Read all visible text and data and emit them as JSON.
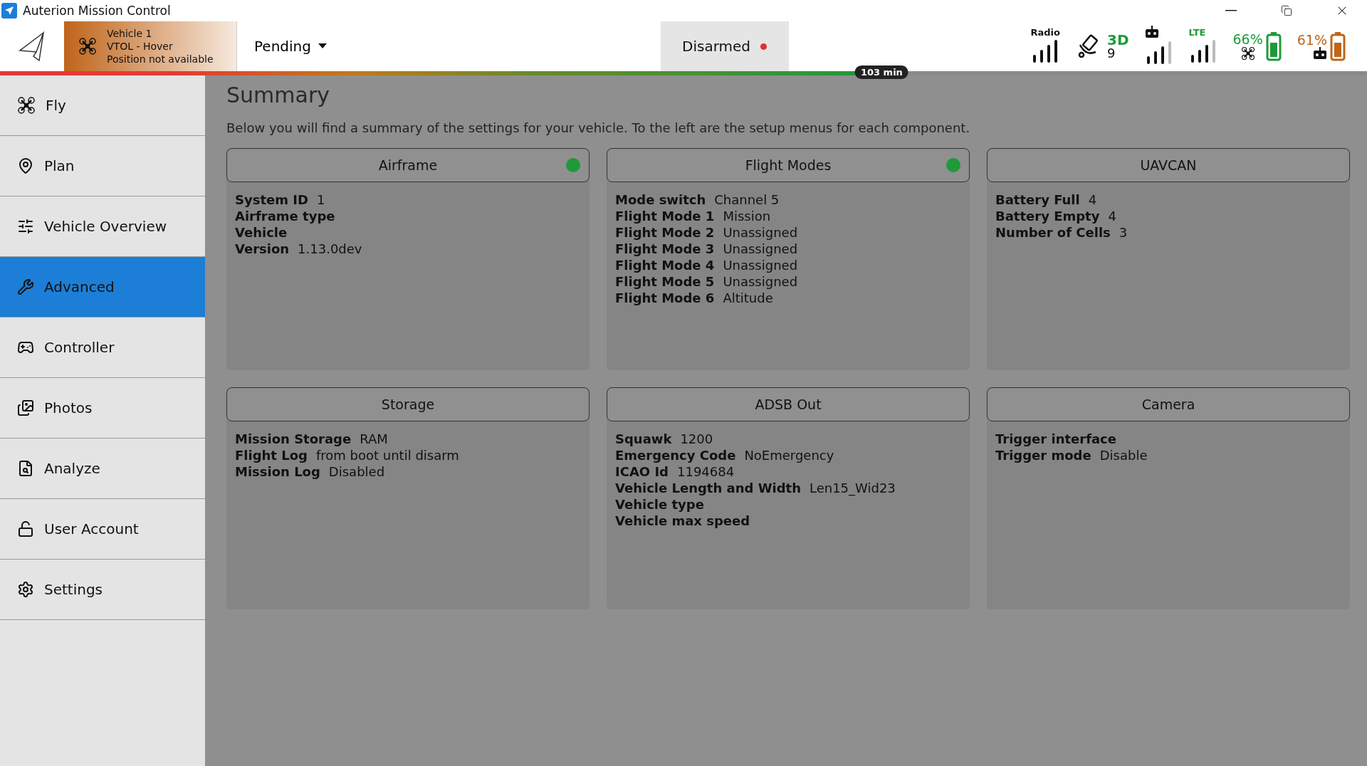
{
  "window": {
    "title": "Auterion Mission Control"
  },
  "toolbar": {
    "vehicle": {
      "lines": [
        "Vehicle 1",
        "VTOL - Hover",
        "Position not available"
      ]
    },
    "flight_status": "Pending",
    "arm_state": "Disarmed",
    "flight_time": {
      "label": "103 min",
      "level": 0.645
    },
    "indicators": [
      {
        "kind": "radio",
        "label": "Radio"
      },
      {
        "kind": "gps",
        "fix": "3D",
        "count": "9"
      },
      {
        "kind": "rc"
      },
      {
        "kind": "lte",
        "label": "LTE"
      },
      {
        "kind": "vehicle_battery",
        "label": "66%",
        "color": "#1e9a3a"
      },
      {
        "kind": "rc_battery",
        "label": "61%",
        "color": "#c0651a"
      }
    ]
  },
  "drawer": {
    "items": [
      {
        "kind": "fly",
        "label": "Fly",
        "selected": false
      },
      {
        "kind": "plan",
        "label": "Plan",
        "selected": false
      },
      {
        "kind": "overview",
        "label": "Vehicle Overview",
        "selected": false
      },
      {
        "kind": "advanced",
        "label": "Advanced",
        "selected": true
      },
      {
        "kind": "controller",
        "label": "Controller",
        "selected": false
      },
      {
        "kind": "photos",
        "label": "Photos",
        "selected": false
      },
      {
        "kind": "analyze",
        "label": "Analyze",
        "selected": false
      },
      {
        "kind": "account",
        "label": "User Account",
        "selected": false
      },
      {
        "kind": "settings",
        "label": "Settings",
        "selected": false
      }
    ]
  },
  "summary": {
    "title": "Summary",
    "description": "Below you will find a summary of the settings for your vehicle. To the left are the setup menus for each component.",
    "cards": [
      {
        "title": "Airframe",
        "ok": true,
        "rows": [
          {
            "label": "System ID",
            "value": "1"
          },
          {
            "label": "Airframe type"
          },
          {
            "label": "Vehicle"
          },
          {
            "label": "Version",
            "value": "1.13.0dev"
          }
        ]
      },
      {
        "title": "Flight Modes",
        "ok": true,
        "rows": [
          {
            "label": "Mode switch",
            "value": "Channel 5"
          },
          {
            "label": "Flight Mode 1",
            "value": "Mission"
          },
          {
            "label": "Flight Mode 2",
            "value": "Unassigned"
          },
          {
            "label": "Flight Mode 3",
            "value": "Unassigned"
          },
          {
            "label": "Flight Mode 4",
            "value": "Unassigned"
          },
          {
            "label": "Flight Mode 5",
            "value": "Unassigned"
          },
          {
            "label": "Flight Mode 6",
            "value": "Altitude"
          }
        ]
      },
      {
        "title": "UAVCAN",
        "ok": false,
        "rows": [
          {
            "label": "Battery Full",
            "value": "4"
          },
          {
            "label": "Battery Empty",
            "value": "4"
          },
          {
            "label": "Number of Cells",
            "value": "3"
          }
        ]
      },
      {
        "title": "Storage",
        "ok": false,
        "rows": [
          {
            "label": "Mission Storage",
            "value": "RAM"
          },
          {
            "label": "Flight Log",
            "value": "from boot until disarm"
          },
          {
            "label": "Mission Log",
            "value": "Disabled"
          }
        ]
      },
      {
        "title": "ADSB Out",
        "ok": false,
        "rows": [
          {
            "label": "Squawk",
            "value": "1200"
          },
          {
            "label": "Emergency Code",
            "value": "NoEmergency"
          },
          {
            "label": "ICAO Id",
            "value": "1194684"
          },
          {
            "label": "Vehicle Length and Width",
            "value": "Len15_Wid23"
          },
          {
            "label": "Vehicle type"
          },
          {
            "label": "Vehicle max speed"
          }
        ]
      },
      {
        "title": "Camera",
        "ok": false,
        "rows": [
          {
            "label": "Trigger interface"
          },
          {
            "label": "Trigger mode",
            "value": "Disable"
          }
        ]
      }
    ]
  }
}
